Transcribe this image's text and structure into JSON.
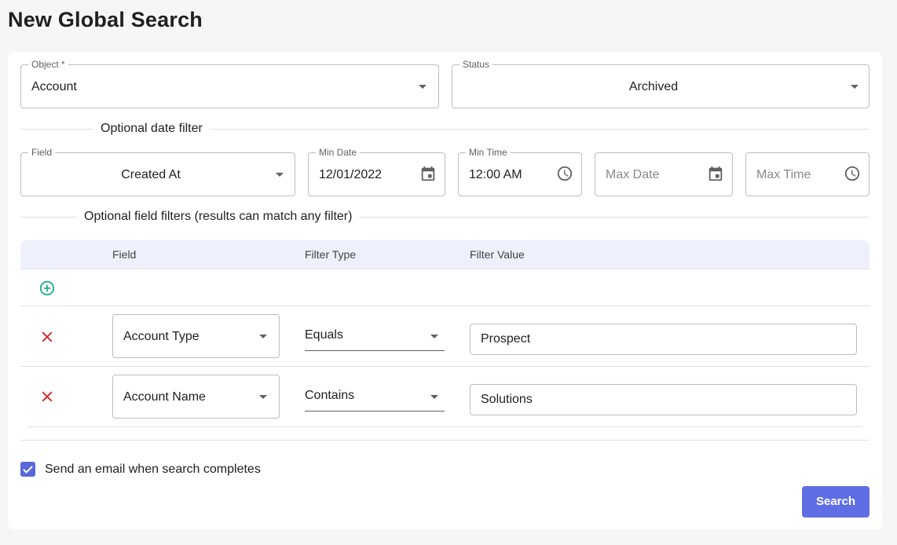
{
  "page": {
    "title": "New Global Search"
  },
  "object_select": {
    "label": "Object *",
    "value": "Account"
  },
  "status_select": {
    "label": "Status",
    "value": "Archived"
  },
  "date_filter": {
    "section_label": "Optional date filter",
    "field": {
      "label": "Field",
      "value": "Created At"
    },
    "min_date": {
      "label": "Min Date",
      "value": "12/01/2022"
    },
    "min_time": {
      "label": "Min Time",
      "value": "12:00 AM"
    },
    "max_date": {
      "placeholder": "Max Date"
    },
    "max_time": {
      "placeholder": "Max Time"
    }
  },
  "field_filters": {
    "section_label": "Optional field filters (results can match any filter)",
    "columns": [
      "Field",
      "Filter Type",
      "Filter Value"
    ],
    "rows": [
      {
        "field": "Account Type",
        "filter_type": "Equals",
        "filter_value": "Prospect"
      },
      {
        "field": "Account Name",
        "filter_type": "Contains",
        "filter_value": "Solutions"
      }
    ]
  },
  "email_option": {
    "label": "Send an email when search completes",
    "checked": true
  },
  "actions": {
    "search_label": "Search"
  },
  "colors": {
    "accent": "#5f6ee5",
    "add": "#1bb08a",
    "remove": "#d32f2f",
    "header_bg": "#eef0fb"
  }
}
